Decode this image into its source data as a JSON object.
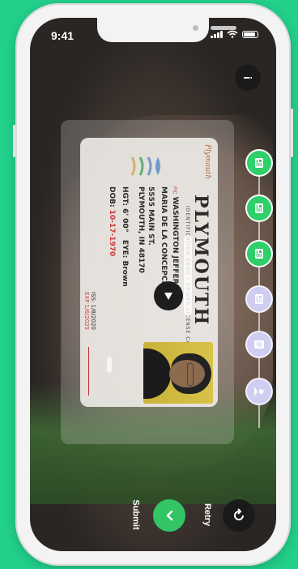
{
  "status": {
    "time": "9:41"
  },
  "info_button": {
    "label": "i"
  },
  "card": {
    "state": "PLYMOUTH",
    "subtitle": "IDENTIFICATION CARD / DRIVER LICENSE CARD",
    "line1_tag": "PIC",
    "line1": "WASHINGTON JEFFERSON",
    "line2_tag": "",
    "line2": "MARIA DE LA CONCEPCION",
    "line3": "5555 MAIN ST.",
    "line4": "PLYMOUTH, IN 48170",
    "hgt": "HGT: 6' 00\"",
    "eyes": "EYE: Brown",
    "dob_label": "DOB:",
    "dob": "10-17-1970",
    "iss": "ISS: 1/8/2020",
    "exp": "EXP 1/6/2025",
    "signature_text": "Plymouth"
  },
  "steps": [
    {
      "name": "step-1",
      "status": "done",
      "icon": "id-card-icon"
    },
    {
      "name": "step-2",
      "status": "done",
      "icon": "id-card-icon"
    },
    {
      "name": "step-3",
      "status": "done",
      "icon": "id-card-icon"
    },
    {
      "name": "step-4",
      "status": "todo",
      "icon": "id-card-icon"
    },
    {
      "name": "step-5",
      "status": "todo",
      "icon": "document-icon"
    },
    {
      "name": "step-6",
      "status": "todo",
      "icon": "user-icon"
    }
  ],
  "actions": {
    "submit_label": "Submit",
    "retry_label": "Retry"
  },
  "colors": {
    "accent": "#33c465",
    "background": "#22d08a",
    "pending": "#cfcdf0"
  }
}
